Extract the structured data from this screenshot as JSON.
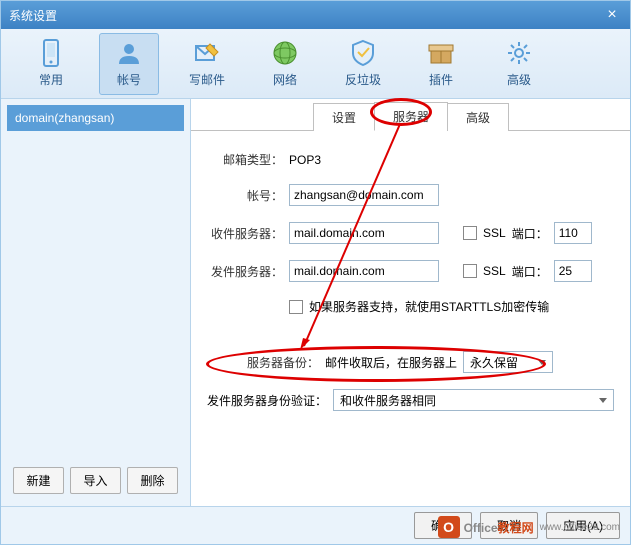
{
  "title": "系统设置",
  "toolbar": [
    {
      "label": "常用",
      "icon": "phone"
    },
    {
      "label": "帐号",
      "icon": "user"
    },
    {
      "label": "写邮件",
      "icon": "compose"
    },
    {
      "label": "网络",
      "icon": "globe"
    },
    {
      "label": "反垃圾",
      "icon": "shield"
    },
    {
      "label": "插件",
      "icon": "box"
    },
    {
      "label": "高级",
      "icon": "gear"
    }
  ],
  "account_name": "domain(zhangsan)",
  "side_buttons": {
    "new": "新建",
    "import": "导入",
    "delete": "删除"
  },
  "tabs": [
    "设置",
    "服务器",
    "高级"
  ],
  "form": {
    "mailbox_type_label": "邮箱类型：",
    "mailbox_type_value": "POP3",
    "account_label": "帐号：",
    "account_value": "zhangsan@domain.com",
    "incoming_label": "收件服务器：",
    "incoming_value": "mail.domain.com",
    "outgoing_label": "发件服务器：",
    "outgoing_value": "mail.domain.com",
    "ssl_label": "SSL",
    "port_label": "端口：",
    "port_in": "110",
    "port_out": "25",
    "starttls_label": "如果服务器支持，就使用STARTTLS加密传输",
    "backup_label": "服务器备份：",
    "backup_text": "邮件收取后，在服务器上",
    "backup_value": "永久保留",
    "auth_label": "发件服务器身份验证：",
    "auth_value": "和收件服务器相同"
  },
  "footer": {
    "ok": "确定",
    "cancel": "取消",
    "apply": "应用(A)"
  },
  "watermark": {
    "brand1": "Office",
    "brand2": "教程网",
    "url": "www.office26.com"
  }
}
